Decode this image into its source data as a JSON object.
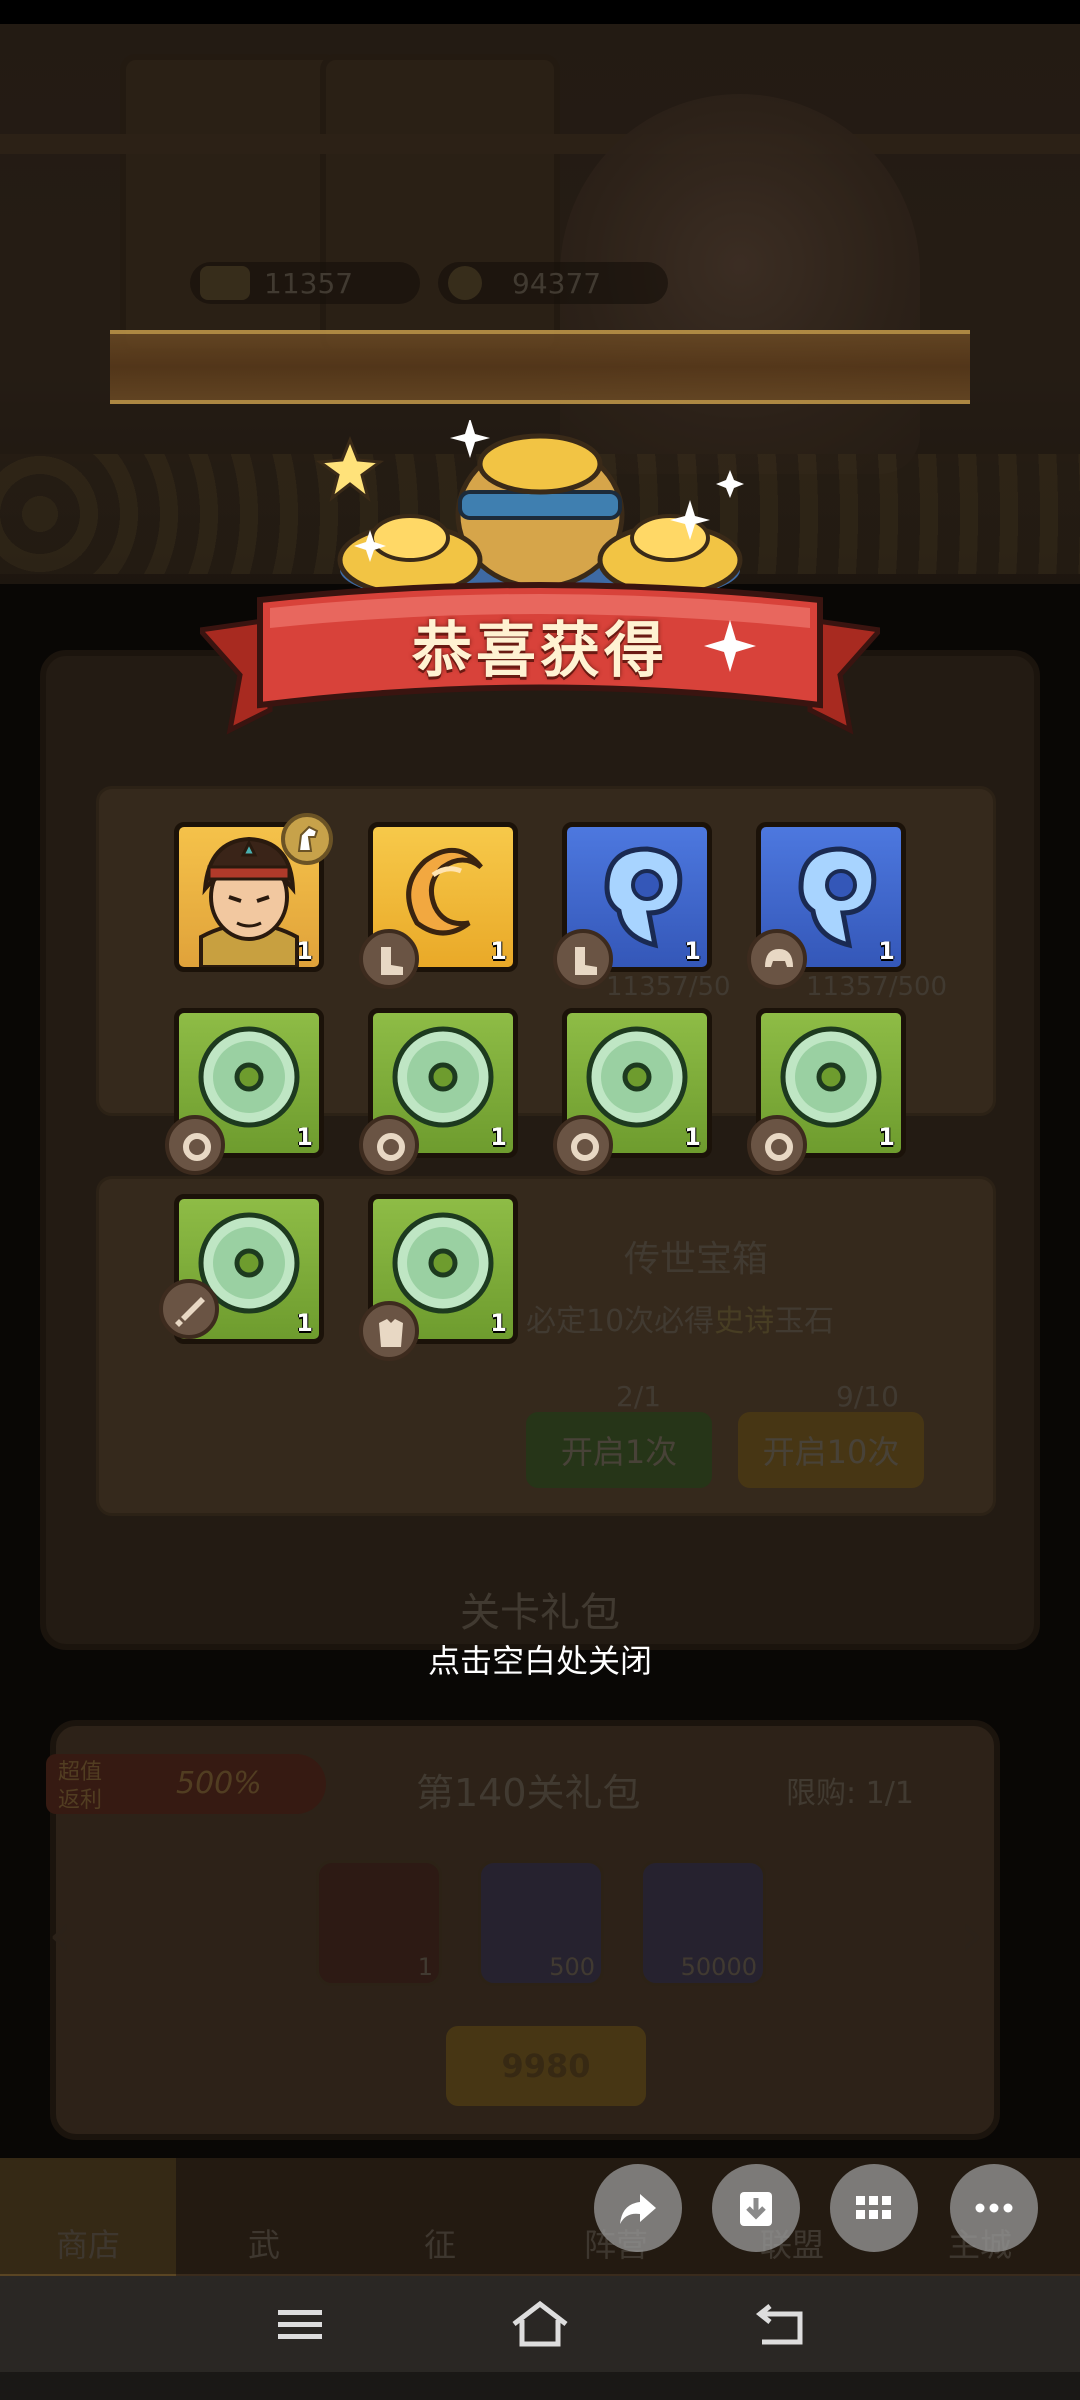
{
  "resources": [
    {
      "icon": "ingot-icon",
      "value": "11357"
    },
    {
      "icon": "coin-icon",
      "value": "94377"
    }
  ],
  "popup": {
    "title": "恭喜获得",
    "close_hint": "点击空白处关闭",
    "items": [
      {
        "name": "hero-portrait",
        "count": "1",
        "badge_icon": "horse-icon",
        "color": "#f5c24a"
      },
      {
        "name": "gold-horn-item",
        "count": "1",
        "badge_icon": "boots-icon",
        "color": "#f7c94a"
      },
      {
        "name": "blue-horn-item",
        "count": "1",
        "badge_icon": "boots-icon",
        "color": "#4d78df"
      },
      {
        "name": "blue-horn-item",
        "count": "1",
        "badge_icon": "helmet-icon",
        "color": "#4d78df"
      },
      {
        "name": "jade-disc-item",
        "count": "1",
        "badge_icon": "ring-icon",
        "color": "#8ebc46"
      },
      {
        "name": "jade-disc-item",
        "count": "1",
        "badge_icon": "ring-icon",
        "color": "#8ebc46"
      },
      {
        "name": "jade-disc-item",
        "count": "1",
        "badge_icon": "ring-icon",
        "color": "#8ebc46"
      },
      {
        "name": "jade-disc-item",
        "count": "1",
        "badge_icon": "ring-icon",
        "color": "#8ebc46"
      },
      {
        "name": "jade-disc-item",
        "count": "1",
        "badge_icon": "sword-icon",
        "color": "#8ebc46"
      },
      {
        "name": "jade-disc-item",
        "count": "1",
        "badge_icon": "armor-icon",
        "color": "#8ebc46"
      }
    ]
  },
  "background": {
    "chest_panel": {
      "name": "传世宝箱",
      "desc_prefix": "必定10次必得",
      "desc_highlight": "史诗",
      "desc_suffix": "玉石",
      "key1_progress": "2/1",
      "key10_progress": "9/10",
      "open1_label": "开启1次",
      "open10_label": "开启10次",
      "progress_left": "11357/50",
      "progress_right": "11357/500"
    },
    "section_title": "关卡礼包",
    "gift": {
      "tag_line1": "超值",
      "tag_line2": "返利",
      "percent": "500%",
      "title": "第140关礼包",
      "limit": "限购: 1/1",
      "rewards": [
        "1",
        "500",
        "50000"
      ],
      "price": "9980"
    },
    "tabs": [
      "商店",
      "",
      "",
      "",
      "",
      ""
    ],
    "tab_partial_labels": [
      "商店",
      "武",
      "征",
      "阵营",
      "联盟",
      "主城"
    ]
  },
  "fabs": [
    "share-icon",
    "download-icon",
    "grid-icon",
    "more-icon"
  ],
  "sysnav": [
    "menu-icon",
    "home-icon",
    "back-icon"
  ]
}
